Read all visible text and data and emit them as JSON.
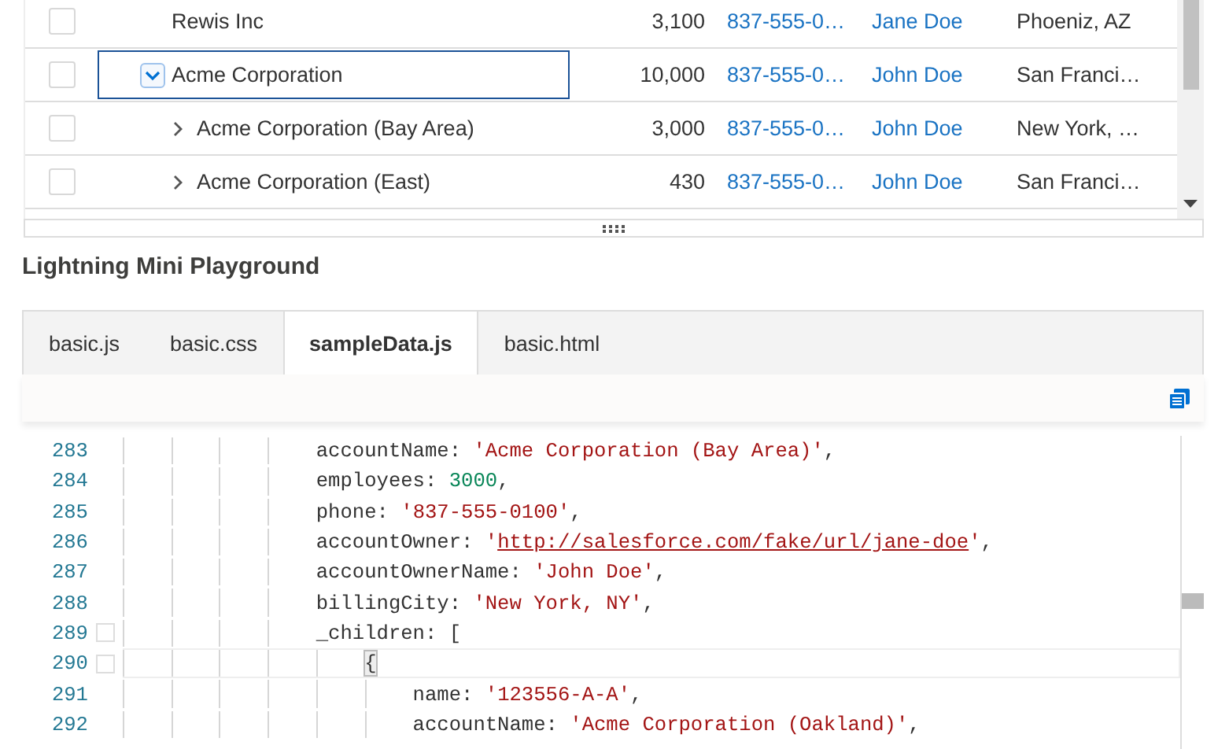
{
  "table": {
    "rows": [
      {
        "name": "Rewis Inc",
        "employees": "3,100",
        "phone": "837-555-0…",
        "owner": "Jane Doe",
        "city": "Phoeniz, AZ",
        "checked": false,
        "focused": false
      },
      {
        "name": "Acme Corporation",
        "employees": "10,000",
        "phone": "837-555-0…",
        "owner": "John Doe",
        "city": "San Franci…",
        "checked": false,
        "focused": true,
        "expanded": true,
        "children": [
          {
            "name": "Acme Corporation (Bay Area)",
            "employees": "3,000",
            "phone": "837-555-0…",
            "owner": "John Doe",
            "city": "New York, …",
            "checked": false,
            "focused": false,
            "expanded": false
          },
          {
            "name": "Acme Corporation (East)",
            "employees": "430",
            "phone": "837-555-0…",
            "owner": "John Doe",
            "city": "San Franci…",
            "checked": false,
            "focused": false,
            "expanded": false
          }
        ]
      }
    ]
  },
  "playground": {
    "title": "Lightning Mini Playground",
    "tabs": [
      {
        "label": "basic.js",
        "selected": false
      },
      {
        "label": "basic.css",
        "selected": false
      },
      {
        "label": "sampleData.js",
        "selected": true
      },
      {
        "label": "basic.html",
        "selected": false
      }
    ],
    "code": [
      {
        "number": "283",
        "current": false,
        "foldable": false,
        "tokens": [
          {
            "kind": "plain",
            "text": "                accountName: "
          },
          {
            "kind": "string",
            "text": "'Acme Corporation (Bay Area)'"
          },
          {
            "kind": "plain",
            "text": ","
          }
        ]
      },
      {
        "number": "284",
        "current": false,
        "foldable": false,
        "tokens": [
          {
            "kind": "plain",
            "text": "                employees: "
          },
          {
            "kind": "number",
            "text": "3000"
          },
          {
            "kind": "plain",
            "text": ","
          }
        ]
      },
      {
        "number": "285",
        "current": false,
        "foldable": false,
        "tokens": [
          {
            "kind": "plain",
            "text": "                phone: "
          },
          {
            "kind": "string",
            "text": "'837-555-0100'"
          },
          {
            "kind": "plain",
            "text": ","
          }
        ]
      },
      {
        "number": "286",
        "current": false,
        "foldable": false,
        "tokens": [
          {
            "kind": "plain",
            "text": "                accountOwner: "
          },
          {
            "kind": "string",
            "text": "'"
          },
          {
            "kind": "link",
            "text": "http://salesforce.com/fake/url/jane-doe"
          },
          {
            "kind": "string",
            "text": "'"
          },
          {
            "kind": "plain",
            "text": ","
          }
        ]
      },
      {
        "number": "287",
        "current": false,
        "foldable": false,
        "tokens": [
          {
            "kind": "plain",
            "text": "                accountOwnerName: "
          },
          {
            "kind": "string",
            "text": "'John Doe'"
          },
          {
            "kind": "plain",
            "text": ","
          }
        ]
      },
      {
        "number": "288",
        "current": false,
        "foldable": false,
        "tokens": [
          {
            "kind": "plain",
            "text": "                billingCity: "
          },
          {
            "kind": "string",
            "text": "'New York, NY'"
          },
          {
            "kind": "plain",
            "text": ","
          }
        ]
      },
      {
        "number": "289",
        "current": false,
        "foldable": true,
        "tokens": [
          {
            "kind": "plain",
            "text": "                _children: ["
          }
        ]
      },
      {
        "number": "290",
        "current": true,
        "foldable": true,
        "tokens": [
          {
            "kind": "bracket",
            "text": "                    {"
          }
        ]
      },
      {
        "number": "291",
        "current": false,
        "foldable": false,
        "tokens": [
          {
            "kind": "plain",
            "text": "                        name: "
          },
          {
            "kind": "string",
            "text": "'123556-A-A'"
          },
          {
            "kind": "plain",
            "text": ","
          }
        ]
      },
      {
        "number": "292",
        "current": false,
        "foldable": false,
        "tokens": [
          {
            "kind": "plain",
            "text": "                        accountName: "
          },
          {
            "kind": "string",
            "text": "'Acme Corporation (Oakland)'"
          },
          {
            "kind": "plain",
            "text": ","
          }
        ]
      }
    ]
  }
}
